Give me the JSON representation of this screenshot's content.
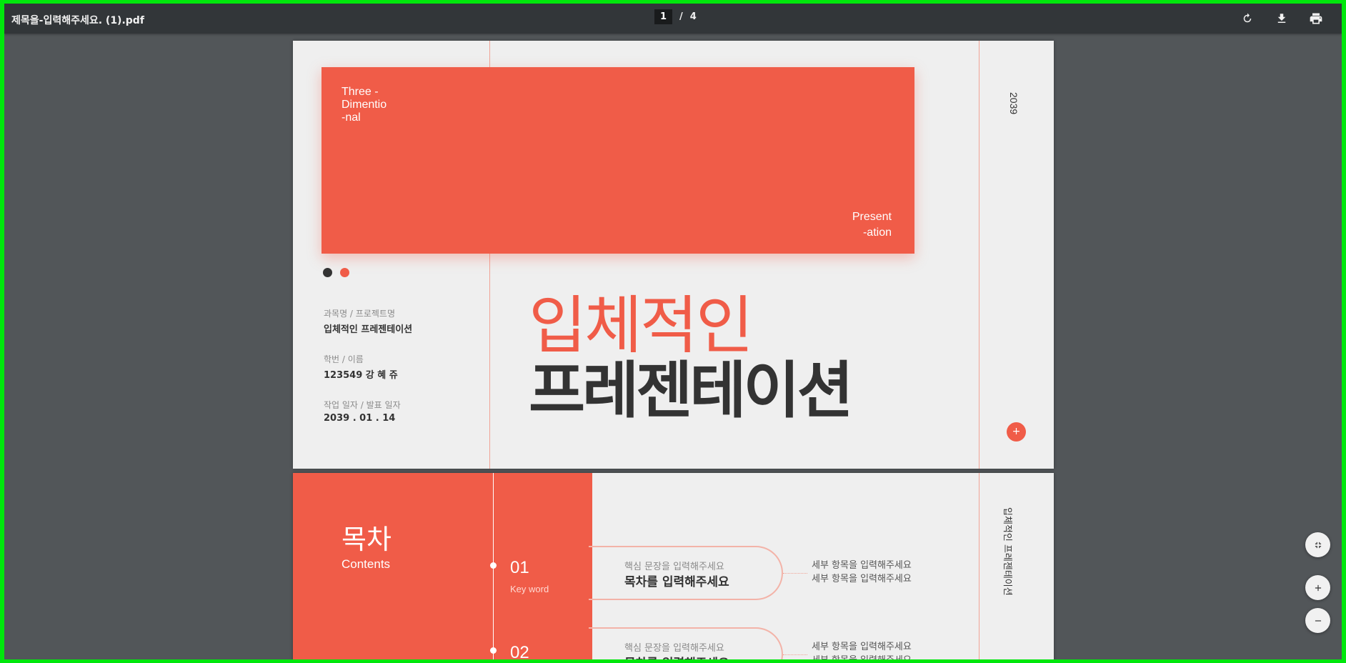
{
  "viewer": {
    "file_name": "제목을-입력해주세요. (1).pdf",
    "current_page": "1",
    "page_separator": "/",
    "total_pages": "4",
    "toolbar_icons": [
      "rotate-icon",
      "download-icon",
      "print-icon"
    ],
    "zoom_icons": [
      "fit-page-icon",
      "zoom-in-icon",
      "zoom-out-icon"
    ]
  },
  "slide1": {
    "box_text_lines": [
      "Three -",
      "Dimentio",
      "-nal"
    ],
    "box_corner_lines": [
      "Present",
      "-ation"
    ],
    "year": "2039",
    "course_label": "과목명 / 프로젝트명",
    "course_value": "입체적인 프레젠테이션",
    "id_label": "학번 /  이름",
    "id_value": "123549  강 혜 쥬",
    "date_label": "작업 일자 / 발표 일자",
    "date_value": "2039 . 01 . 14",
    "title_line1": "입체적인",
    "title_line2": "프레젠테이션",
    "plus_glyph": "+"
  },
  "slide2": {
    "toc_title": "목차",
    "toc_subtitle": "Contents",
    "side_vertical_text": "입체적인 프레젠테이션",
    "items": [
      {
        "number": "01",
        "keyword": "Key word",
        "core_sentence": "핵심 문장을 입력해주세요",
        "heading": "목차를 입력해주세요",
        "detail1": "세부 항목을 입력해주세요",
        "detail2": "세부 항목을 입력해주세요"
      },
      {
        "number": "02",
        "core_sentence": "핵심 문장을 입력해주세요",
        "heading": "목차를 입력해주세요",
        "detail1": "세부 항목을 입력해주세요",
        "detail2": "세부 항목을 입력해주세요"
      }
    ]
  },
  "colors": {
    "accent": "#f05c48",
    "toolbar": "#323639",
    "viewer_bg": "#525659",
    "page_bg": "#efefef",
    "text_dark": "#333333",
    "frame_border": "#00e70c"
  }
}
